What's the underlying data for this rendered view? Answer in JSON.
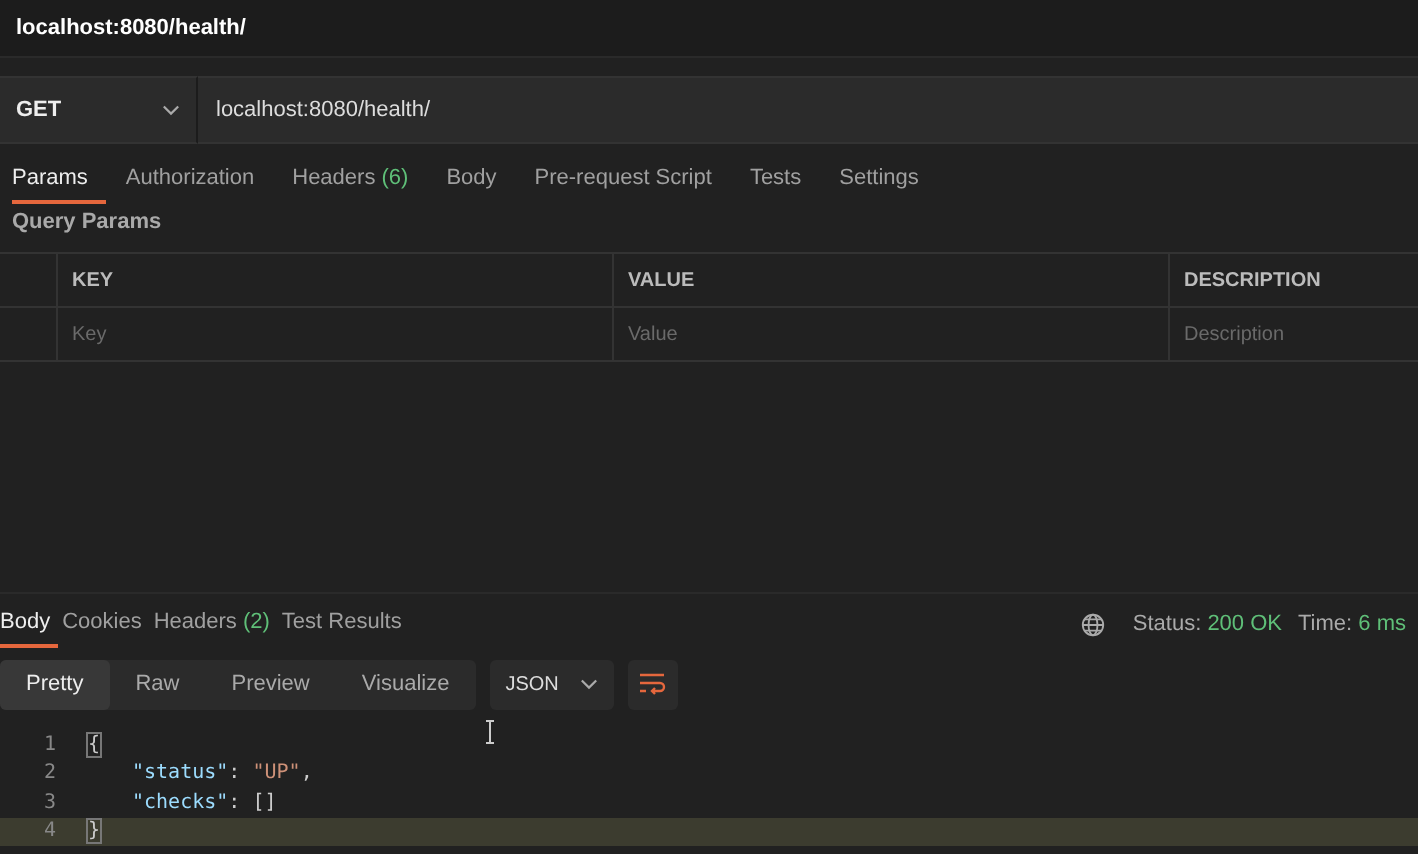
{
  "request_title": "localhost:8080/health/",
  "request": {
    "method": "GET",
    "url": "localhost:8080/health/"
  },
  "request_tabs": [
    {
      "label": "Params",
      "selected": true
    },
    {
      "label": "Authorization",
      "selected": false
    },
    {
      "label": "Headers",
      "count": "(6)",
      "selected": false
    },
    {
      "label": "Body",
      "selected": false
    },
    {
      "label": "Pre-request Script",
      "selected": false
    },
    {
      "label": "Tests",
      "selected": false
    },
    {
      "label": "Settings",
      "selected": false
    }
  ],
  "query_params": {
    "title": "Query Params",
    "columns": [
      "KEY",
      "VALUE",
      "DESCRIPTION"
    ],
    "placeholders": [
      "Key",
      "Value",
      "Description"
    ]
  },
  "response_tabs": [
    {
      "label": "Body",
      "selected": true
    },
    {
      "label": "Cookies",
      "selected": false
    },
    {
      "label": "Headers",
      "count": "(2)",
      "selected": false
    },
    {
      "label": "Test Results",
      "selected": false
    }
  ],
  "response_status": {
    "status_label": "Status:",
    "status": "200 OK",
    "time_label": "Time:",
    "time": "6 ms"
  },
  "view_modes": [
    {
      "label": "Pretty",
      "selected": true
    },
    {
      "label": "Raw",
      "selected": false
    },
    {
      "label": "Preview",
      "selected": false
    },
    {
      "label": "Visualize",
      "selected": false
    }
  ],
  "format": "JSON",
  "code_lines": [
    {
      "number": "1",
      "current": false,
      "tokens": [
        {
          "kind": "bracket",
          "text": "{"
        }
      ]
    },
    {
      "number": "2",
      "current": false,
      "tokens": [
        {
          "kind": "key",
          "text": "\"status\""
        },
        {
          "kind": "punct",
          "text": ": "
        },
        {
          "kind": "string",
          "text": "\"UP\""
        },
        {
          "kind": "punct",
          "text": ","
        }
      ]
    },
    {
      "number": "3",
      "current": false,
      "tokens": [
        {
          "kind": "key",
          "text": "\"checks\""
        },
        {
          "kind": "punct",
          "text": ": []"
        }
      ]
    },
    {
      "number": "4",
      "current": true,
      "tokens": [
        {
          "kind": "bracket",
          "text": "}"
        }
      ]
    }
  ]
}
